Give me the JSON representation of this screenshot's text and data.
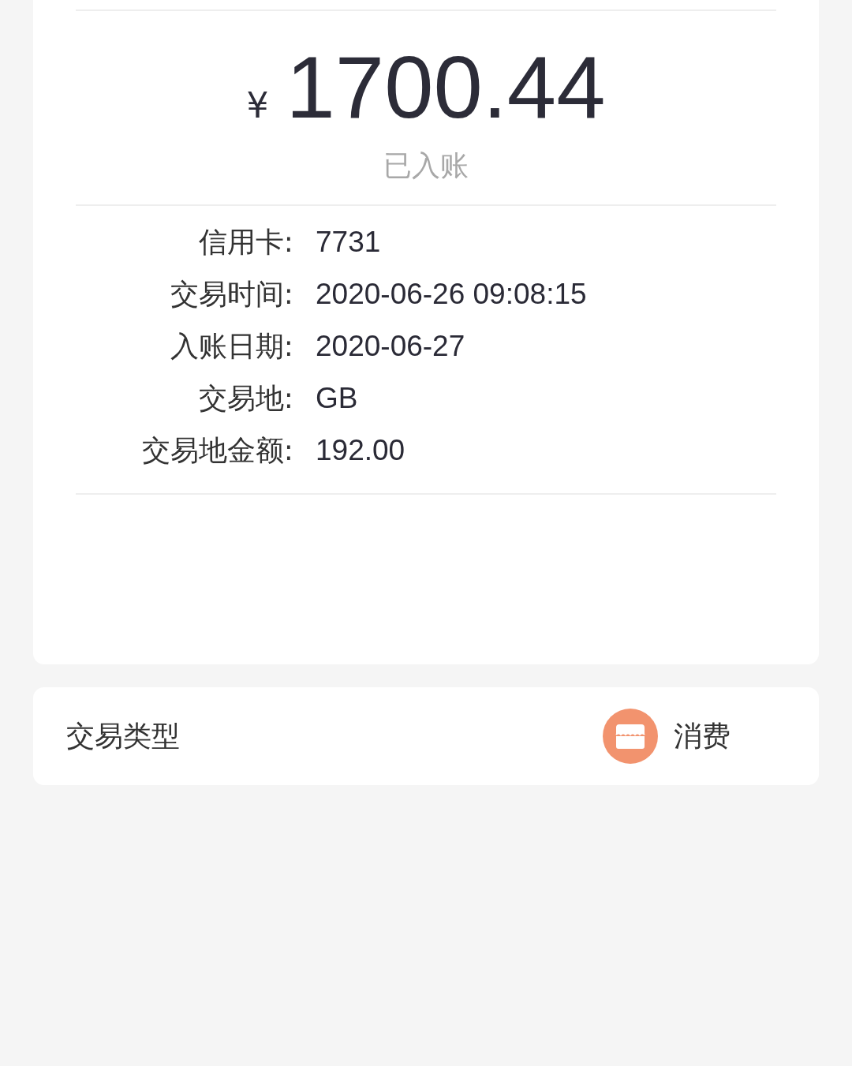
{
  "amount": {
    "currency": "¥",
    "value": "1700.44",
    "status": "已入账"
  },
  "details": [
    {
      "label": "信用卡:",
      "value": "7731"
    },
    {
      "label": "交易时间:",
      "value": "2020-06-26 09:08:15"
    },
    {
      "label": "入账日期:",
      "value": "2020-06-27"
    },
    {
      "label": "交易地:",
      "value": "GB"
    },
    {
      "label": "交易地金额:",
      "value": "192.00"
    }
  ],
  "transaction_type": {
    "label": "交易类型",
    "value": "消费",
    "kind": "shop"
  }
}
